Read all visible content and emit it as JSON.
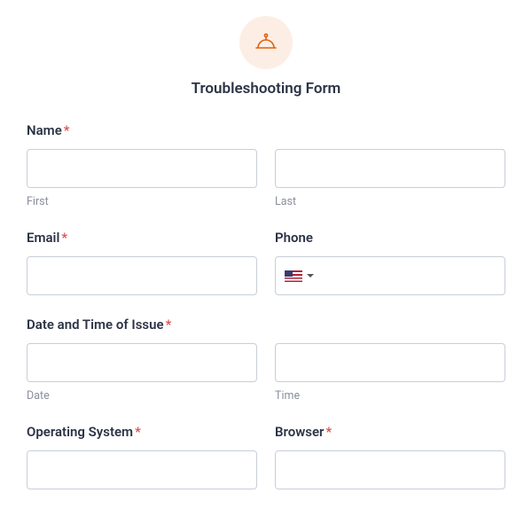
{
  "title": "Troubleshooting Form",
  "name": {
    "label": "Name",
    "required": "*",
    "first_sub": "First",
    "last_sub": "Last"
  },
  "email": {
    "label": "Email",
    "required": "*"
  },
  "phone": {
    "label": "Phone"
  },
  "datetime": {
    "label": "Date and Time of Issue",
    "required": "*",
    "date_sub": "Date",
    "time_sub": "Time"
  },
  "os": {
    "label": "Operating System",
    "required": "*"
  },
  "browser": {
    "label": "Browser",
    "required": "*"
  }
}
